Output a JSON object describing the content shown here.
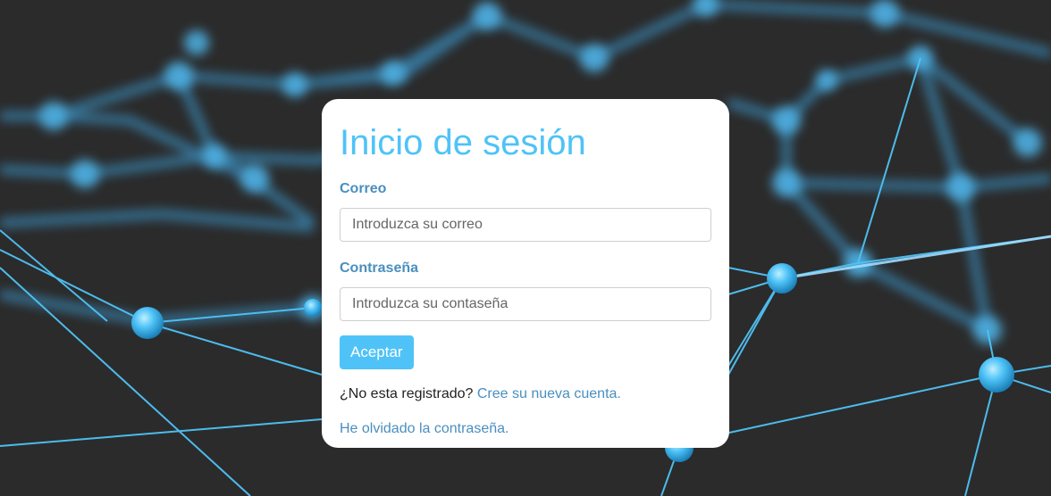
{
  "login": {
    "title": "Inicio de sesión",
    "email_label": "Correo",
    "email_placeholder": "Introduzca su correo",
    "password_label": "Contraseña",
    "password_placeholder": "Introduzca su contaseña",
    "submit_label": "Aceptar",
    "register_prompt": "¿No esta registrado?",
    "register_link": "Cree su nueva cuenta.",
    "forgot_link": "He olvidado la contraseña."
  },
  "colors": {
    "background": "#2b2b2b",
    "accent": "#4fc3f7",
    "link": "#4a8fbf",
    "card": "#ffffff"
  }
}
